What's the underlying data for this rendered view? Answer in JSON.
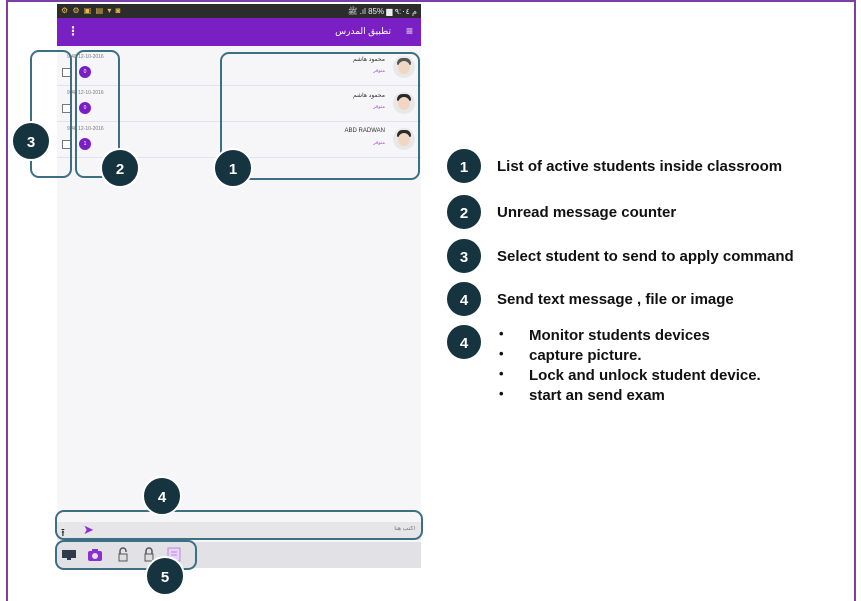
{
  "phone": {
    "statusbar": {
      "left_icons": "⚙ ⚙ ▣ ▤ ▾ ◙",
      "right_text": "ﷺ ‎.ıl 85% ▆ م ٩:٠٤"
    },
    "appbar": {
      "title": "تطبيق المدرس",
      "menu_icon": "hamburger-icon",
      "overflow_icon": "kebab-icon"
    },
    "students": [
      {
        "name": "محمود هاشم",
        "status": "متوفر",
        "date": "9:48 12-10-2016",
        "unread": "0"
      },
      {
        "name": "محمود هاشم",
        "status": "متوفر",
        "date": "9:48 12-10-2016",
        "unread": "0"
      },
      {
        "name": "ABD RADWAN",
        "status": "متوفر",
        "date": "9:48 12-10-2016",
        "unread": "1"
      }
    ],
    "composer": {
      "placeholder": "اكتب هنا"
    },
    "toolbar": [
      "monitor-icon",
      "camera-icon",
      "lock-icon",
      "unlock-icon",
      "exam-icon"
    ]
  },
  "callouts": {
    "c1": "1",
    "c2": "2",
    "c3": "3",
    "c4": "4",
    "c5": "5"
  },
  "legend": {
    "items": [
      {
        "num": "1",
        "text": "List of active students inside classroom"
      },
      {
        "num": "2",
        "text": "Unread message counter"
      },
      {
        "num": "3",
        "text": "Select student to send to apply command"
      },
      {
        "num": "4",
        "text": "Send text message , file or image"
      },
      {
        "num": "4",
        "bullets": [
          "Monitor students devices",
          "capture picture.",
          "Lock and  unlock student device.",
          "start an send exam"
        ]
      }
    ]
  },
  "colors": {
    "accent": "#7a1fc3",
    "callout": "#16343f",
    "outline": "#3d6f84"
  }
}
